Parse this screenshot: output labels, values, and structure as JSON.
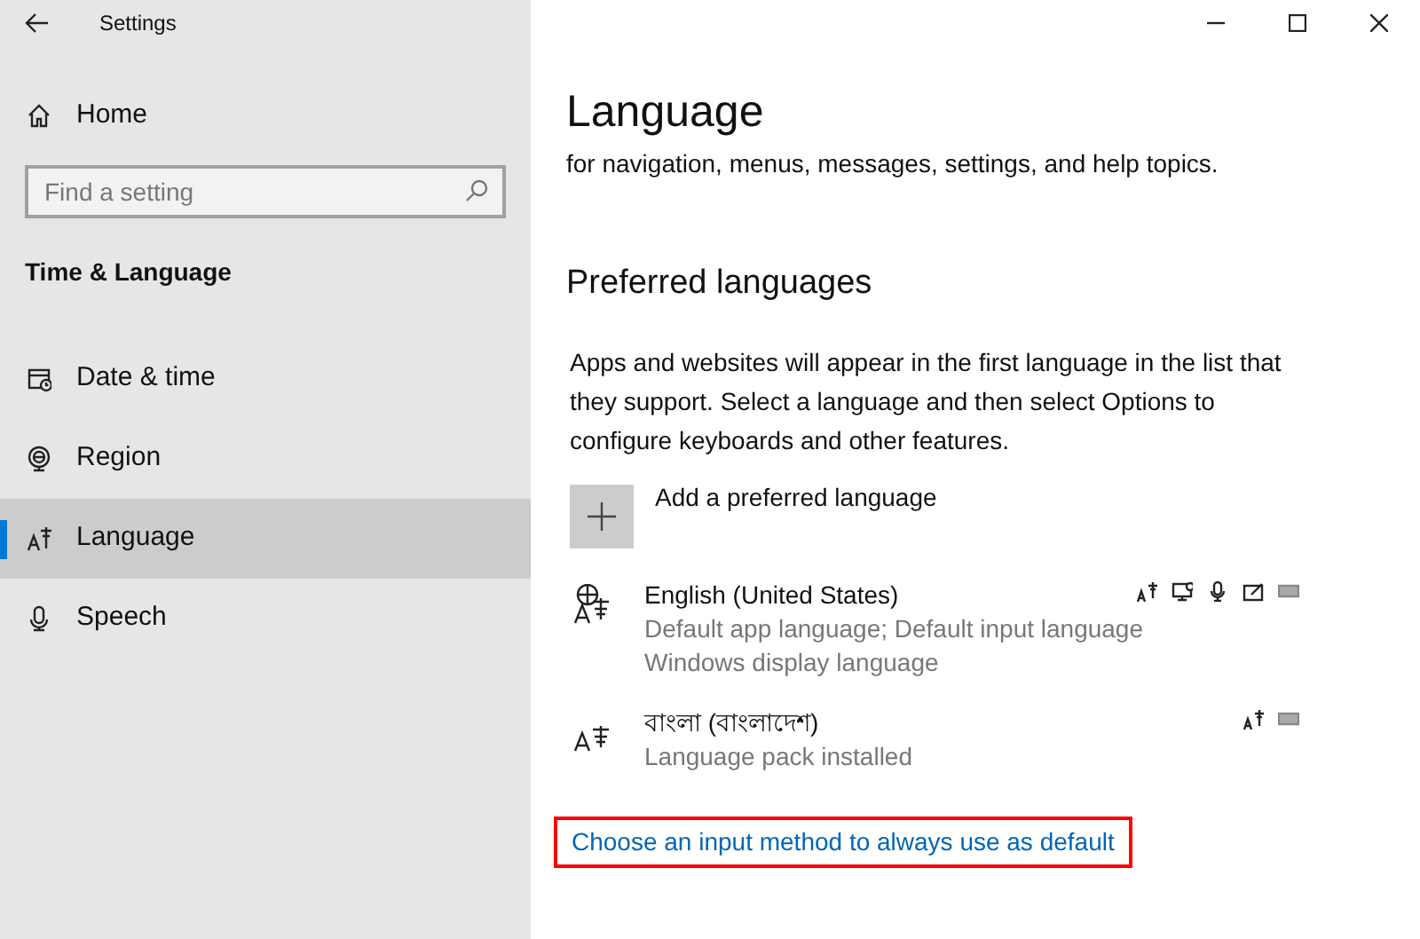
{
  "window": {
    "title": "Settings"
  },
  "sidebar": {
    "home": "Home",
    "search": {
      "placeholder": "Find a setting"
    },
    "section": "Time & Language",
    "items": [
      {
        "label": "Date & time",
        "kind": "calendar",
        "selected": false
      },
      {
        "label": "Region",
        "kind": "globe",
        "selected": false
      },
      {
        "label": "Language",
        "kind": "language",
        "selected": true
      },
      {
        "label": "Speech",
        "kind": "microphone",
        "selected": false
      }
    ]
  },
  "main": {
    "title": "Language",
    "intro": "for navigation, menus, messages, settings, and help topics.",
    "section": "Preferred languages",
    "description": "Apps and websites will appear in the first language in the list that they support. Select a language and then select Options to configure keyboards and other features.",
    "add_button": "Add a preferred language",
    "languages": [
      {
        "name": "English (United States)",
        "details": [
          "Default app language; Default input language",
          "Windows display language"
        ],
        "kind": "display",
        "features": [
          {
            "kind": "text-to-speech"
          },
          {
            "kind": "display"
          },
          {
            "kind": "speech"
          },
          {
            "kind": "handwriting"
          },
          {
            "kind": "keyboard"
          }
        ]
      },
      {
        "name": "বাংলা (বাংলাদেশ)",
        "details": [
          "Language pack installed"
        ],
        "kind": "pack",
        "features": [
          {
            "kind": "text-to-speech"
          },
          {
            "kind": "keyboard"
          }
        ]
      }
    ],
    "link": {
      "label": "Choose an input method to always use as default",
      "highlighted": true
    }
  }
}
